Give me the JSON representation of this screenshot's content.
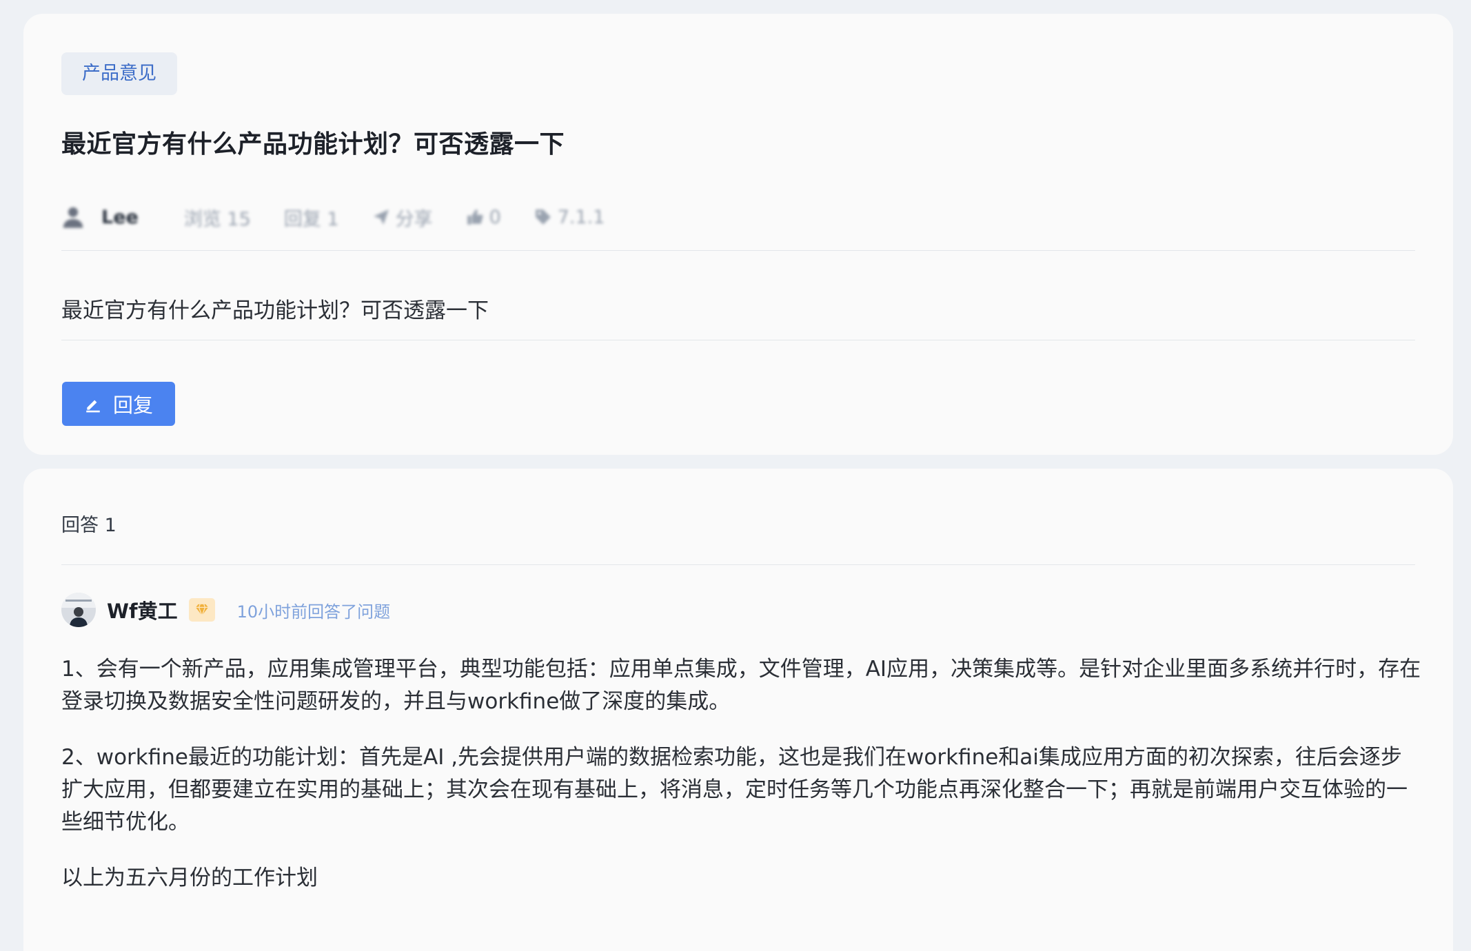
{
  "question": {
    "category": "产品意见",
    "title": "最近官方有什么产品功能计划？可否透露一下",
    "author": "Lee",
    "views_label": "浏览 15",
    "replies_label": "回复 1",
    "share_label": "分享",
    "likes_label": "0",
    "version_label": "7.1.1",
    "body": "最近官方有什么产品功能计划？可否透露一下",
    "reply_button": "回复"
  },
  "answers": {
    "count_label": "回答 1",
    "items": [
      {
        "author": "Wf黄工",
        "time": "10小时前回答了问题",
        "paragraphs": [
          "1、会有一个新产品，应用集成管理平台，典型功能包括：应用单点集成，文件管理，AI应用，决策集成等。是针对企业里面多系统并行时，存在登录切换及数据安全性问题研发的，并且与workfine做了深度的集成。",
          "2、workfine最近的功能计划：首先是AI ,先会提供用户端的数据检索功能，这也是我们在workfine和ai集成应用方面的初次探索，往后会逐步扩大应用，但都要建立在实用的基础上；其次会在现有基础上，将消息，定时任务等几个功能点再深化整合一下；再就是前端用户交互体验的一些细节优化。",
          "以上为五六月份的工作计划"
        ]
      }
    ]
  },
  "colors": {
    "accent": "#4b83f0",
    "tag_bg": "#eaeef4",
    "tag_text": "#3d6dc8",
    "time_text": "#7fa2dc",
    "page_bg": "#eef1f5"
  },
  "icons": {
    "author": "user-icon",
    "share": "send-icon",
    "like": "thumbs-up-icon",
    "version": "tag-icon",
    "reply": "pencil-icon",
    "vip": "diamond-icon"
  }
}
